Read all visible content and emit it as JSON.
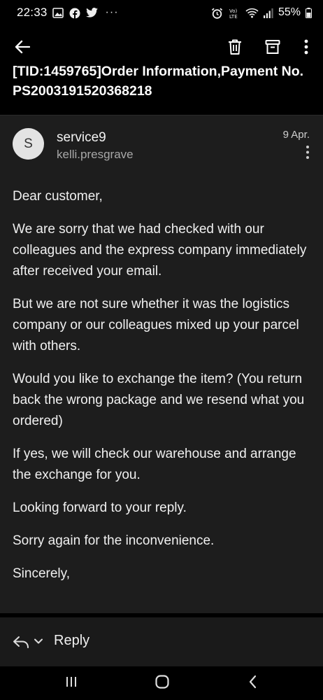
{
  "status_bar": {
    "time": "22:33",
    "left_icons": [
      "gallery-icon",
      "facebook-icon",
      "twitter-icon"
    ],
    "more_notifications": "···",
    "right_icons": [
      "alarm-icon",
      "volte-icon",
      "wifi-icon",
      "signal-icon"
    ],
    "battery_percent": "55%"
  },
  "app_bar": {
    "icons": [
      "back-arrow-icon",
      "trash-icon",
      "archive-icon",
      "more-vert-icon"
    ]
  },
  "subject": "[TID:1459765]Order Information,Payment No.PS2003191520368218",
  "message": {
    "avatar_letter": "S",
    "sender_name": "service9",
    "sender_email": "kelli.presgrave",
    "date": "9 Apr.",
    "body": [
      "Dear customer,",
      "We are sorry that we had checked with our colleagues and the express company immediately after received your email.",
      "But we are not sure whether it was the logistics company or our colleagues mixed up your parcel with others.",
      "Would you like to exchange the item? (You return back the wrong package and we resend what you ordered)",
      "If yes, we will check our warehouse and arrange the exchange for you.",
      "Looking forward to your reply.",
      "Sorry again for the inconvenience.",
      "Sincerely,"
    ]
  },
  "reply_bar": {
    "label": "Reply"
  },
  "nav_bar": {
    "icons": [
      "recent-apps-icon",
      "home-icon",
      "back-icon"
    ]
  },
  "colors": {
    "background": "#000000",
    "card": "#1d1d1d",
    "text": "#f0f0f0",
    "secondary_text": "#a8a8a8",
    "avatar": "#e3e3e3"
  }
}
